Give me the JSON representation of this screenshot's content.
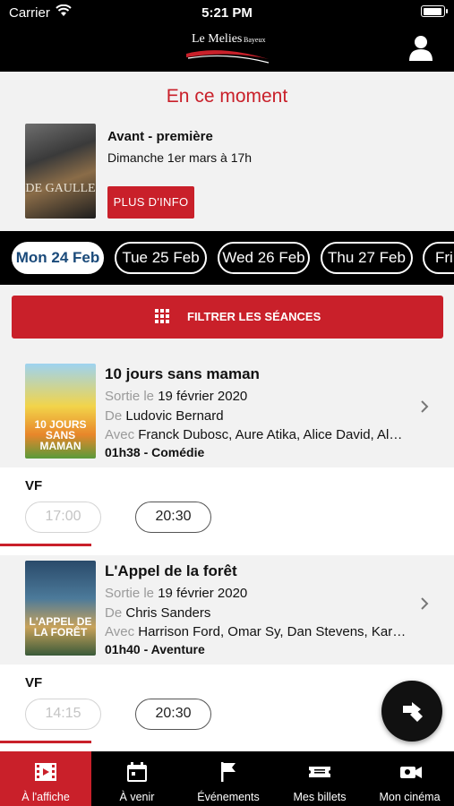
{
  "status": {
    "carrier": "Carrier",
    "time": "5:21 PM"
  },
  "header": {
    "logo_text": "Le Melies",
    "logo_sub": "Bayeux"
  },
  "featured": {
    "heading": "En ce moment",
    "poster_title": "DE GAULLE",
    "title": "Avant - première",
    "date": "Dimanche 1er mars à 17h",
    "button": "PLUS D'INFO"
  },
  "dates": [
    "Mon 24 Feb",
    "Tue 25 Feb",
    "Wed 26 Feb",
    "Thu 27 Feb",
    "Fri"
  ],
  "filter": {
    "label": "FILTRER LES SÉANCES"
  },
  "movies": [
    {
      "title": "10 jours sans maman",
      "poster_title": "10 JOURS SANS MAMAN",
      "release_label": "Sortie le",
      "release": "19 février 2020",
      "director_label": "De",
      "director": "Ludovic Bernard",
      "cast_label": "Avec",
      "cast": "Franck Dubosc, Aure Atika, Alice David, Alexis Michalik",
      "meta": "01h38 - Comédie",
      "language": "VF",
      "times": [
        "17:00",
        "20:30"
      ]
    },
    {
      "title": "L'Appel de la forêt",
      "poster_title": "L'APPEL DE LA FORÊT",
      "release_label": "Sortie le",
      "release": "19 février 2020",
      "director_label": "De",
      "director": "Chris Sanders",
      "cast_label": "Avec",
      "cast": "Harrison Ford, Omar Sy, Dan Stevens, Karen Gillan",
      "meta": "01h40 - Aventure",
      "language": "VF",
      "times": [
        "14:15",
        "20:30"
      ]
    }
  ],
  "tabs": [
    {
      "label": "À l'affiche",
      "icon": "film-icon"
    },
    {
      "label": "À venir",
      "icon": "calendar-icon"
    },
    {
      "label": "Événements",
      "icon": "flag-icon"
    },
    {
      "label": "Mes billets",
      "icon": "ticket-icon"
    },
    {
      "label": "Mon cinéma",
      "icon": "camera-icon"
    }
  ],
  "colors": {
    "accent": "#c9202a",
    "header": "#000000",
    "active_date_text": "#1a4a7a"
  }
}
